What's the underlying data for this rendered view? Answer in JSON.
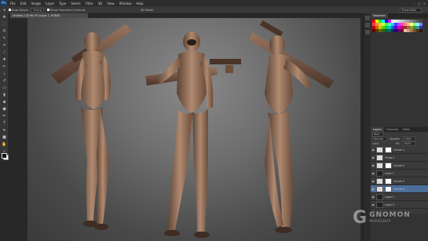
{
  "app": {
    "logo": "Ps"
  },
  "menu": [
    "File",
    "Edit",
    "Image",
    "Layer",
    "Type",
    "Select",
    "Filter",
    "3D",
    "View",
    "Window",
    "Help"
  ],
  "window_controls": [
    "–",
    "□",
    "✕"
  ],
  "options": {
    "tool_option": "Auto-Select:",
    "tool_option_value": "Group",
    "show_transform": "Show Transform Controls",
    "mode_3d": "3D Mode:",
    "workspace": "Essentials"
  },
  "document": {
    "tab": "Untitled-1 @ 66.7% (Layer 1, RGB/8)"
  },
  "tools": [
    "move",
    "marquee",
    "lasso",
    "quick-select",
    "crop",
    "eyedropper",
    "healing",
    "brush",
    "stamp",
    "history-brush",
    "eraser",
    "gradient",
    "blur",
    "dodge",
    "pen",
    "type",
    "path-select",
    "shape",
    "hand",
    "zoom"
  ],
  "panels": {
    "swatches_tabs": [
      "Swatches"
    ],
    "layers_tabs": [
      "Layers",
      "Channels",
      "Paths"
    ],
    "layer_kind": "Kind",
    "blend_mode": "Normal",
    "opacity_label": "Opacity:",
    "opacity_value": "100%",
    "lock_label": "Lock:",
    "fill_label": "Fill:",
    "fill_value": "100%"
  },
  "layers": [
    {
      "name": "Curves 1",
      "type": "adjustment",
      "selected": false
    },
    {
      "name": "Group 1",
      "type": "group",
      "selected": false
    },
    {
      "name": "Curves 2",
      "type": "adjustment",
      "selected": false
    },
    {
      "name": "Layer 2",
      "type": "pixel",
      "selected": false
    },
    {
      "name": "Curves 3",
      "type": "adjustment",
      "selected": false
    },
    {
      "name": "Curves 4",
      "type": "adjustment",
      "selected": true
    },
    {
      "name": "Layer 1",
      "type": "pixel",
      "selected": false
    },
    {
      "name": "Layer 0",
      "type": "pixel",
      "selected": false
    }
  ],
  "swatch_colors": [
    "#ff0000",
    "#ffff00",
    "#00ff00",
    "#00ffff",
    "#0000ff",
    "#ff00ff",
    "#ffffff",
    "#ebebeb",
    "#d6d6d6",
    "#c2c2c2",
    "#adadad",
    "#999999",
    "#858585",
    "#707070",
    "#5c5c5c",
    "#474747",
    "#ff4040",
    "#ff8040",
    "#ffc040",
    "#c0ff40",
    "#40ff40",
    "#40ffc0",
    "#40c0ff",
    "#4040ff",
    "#c040ff",
    "#ff40c0",
    "#ff8080",
    "#ffc080",
    "#ffff80",
    "#80ff80",
    "#80ffff",
    "#8080ff",
    "#cc0000",
    "#cc6600",
    "#cccc00",
    "#66cc00",
    "#00cc66",
    "#00cccc",
    "#0066cc",
    "#6600cc",
    "#cc00cc",
    "#cc0066",
    "#993333",
    "#996633",
    "#999933",
    "#339933",
    "#339999",
    "#333399",
    "#660000",
    "#663300",
    "#666600",
    "#336600",
    "#006633",
    "#006666",
    "#003366",
    "#330066",
    "#660066",
    "#660033",
    "#f2c0a0",
    "#d0a080",
    "#a07850",
    "#785030",
    "#503018",
    "#281808"
  ],
  "watermark": {
    "mark": "G",
    "name": "GNOMON",
    "sub": "WORKSHOP"
  }
}
